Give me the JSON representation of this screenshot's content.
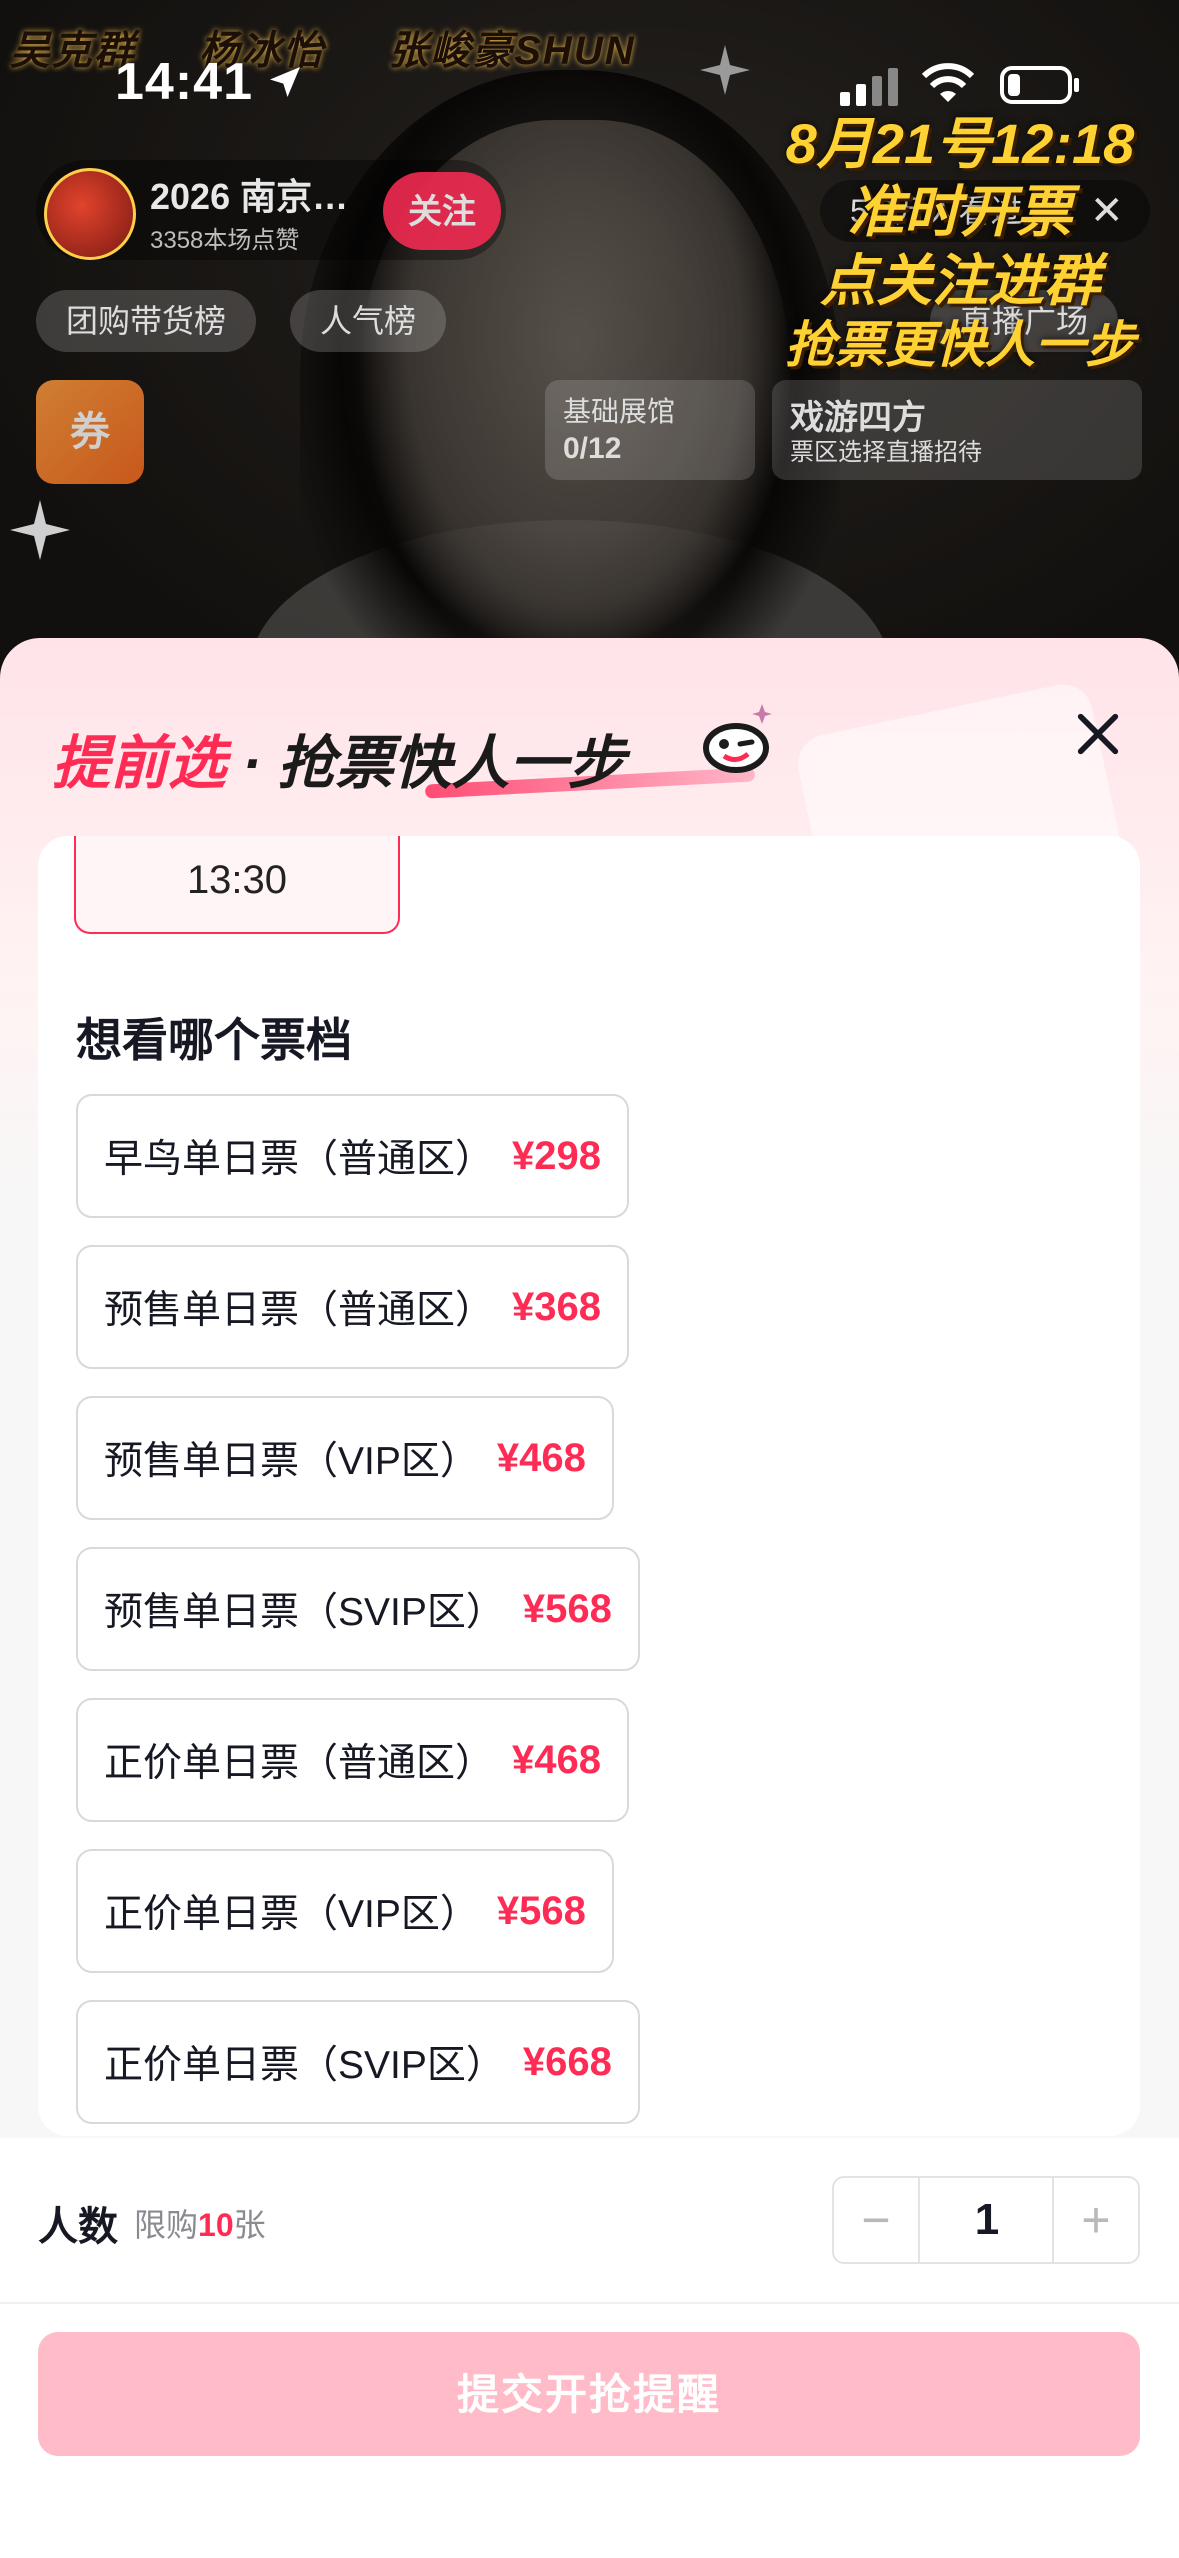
{
  "status_bar": {
    "time": "14:41"
  },
  "live": {
    "name_tags": [
      "吴克群",
      "杨冰怡",
      "张峻豪SHUN"
    ],
    "host_title": "2026 南京…",
    "host_likes": "3358本场点赞",
    "follow_label": "关注",
    "viewers": "5.3万人看过",
    "tags": [
      "团购带货榜",
      "人气榜",
      "直播广场"
    ],
    "coupon": "券",
    "card1": {
      "title": "基础展馆",
      "progress": "0/12"
    },
    "card2": {
      "title": "戏游四方",
      "sub": "票区选择直播招待"
    },
    "promo_lines": [
      "8月21号12:18",
      "准时开票",
      "点关注进群",
      "抢票更快人一步"
    ]
  },
  "sheet": {
    "title_highlight": "提前选",
    "title_dot": "·",
    "title_rest": "抢票快人一步",
    "time_option": "13:30",
    "section_title": "想看哪个票档",
    "tickets": [
      {
        "name": "早鸟单日票（普通区）",
        "price": "¥298"
      },
      {
        "name": "预售单日票（普通区）",
        "price": "¥368"
      },
      {
        "name": "预售单日票（VIP区）",
        "price": "¥468"
      },
      {
        "name": "预售单日票（SVIP区）",
        "price": "¥568"
      },
      {
        "name": "正价单日票（普通区）",
        "price": "¥468"
      },
      {
        "name": "正价单日票（VIP区）",
        "price": "¥568"
      },
      {
        "name": "正价单日票（SVIP区）",
        "price": "¥668"
      }
    ],
    "qty": {
      "label": "人数",
      "limit_prefix": "限购",
      "limit_num": "10",
      "limit_suffix": "张",
      "minus": "−",
      "plus": "+",
      "value": "1"
    },
    "submit_label": "提交开抢提醒"
  },
  "colors": {
    "accent": "#fe2c55",
    "submit_disabled": "#ffbcc8",
    "promo": "#ffd233"
  }
}
